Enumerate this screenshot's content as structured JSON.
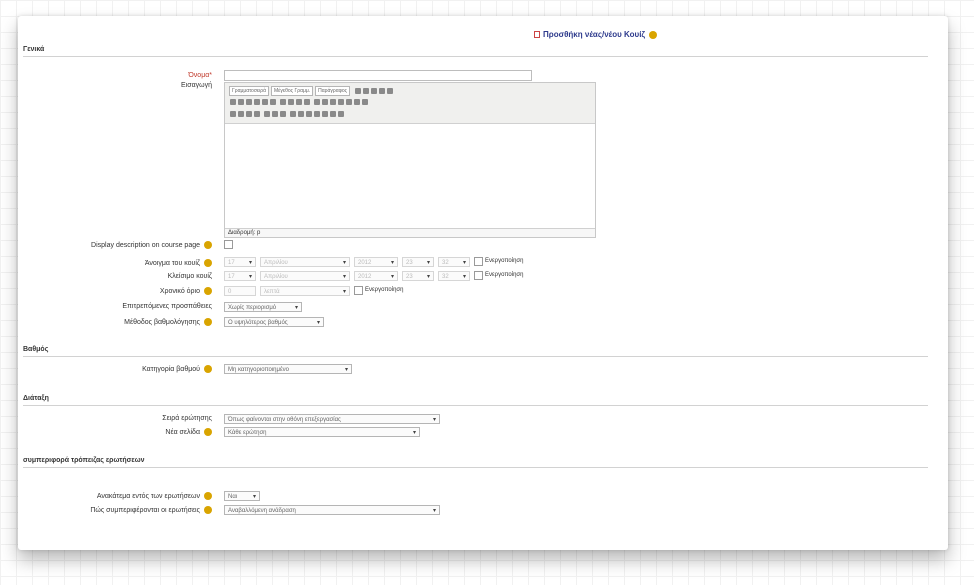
{
  "page": {
    "title": "Προσθήκη νέας/νέου Κουίζ"
  },
  "sections": {
    "general": "Γενικά",
    "grade": "Βαθμός",
    "layout": "Διάταξη",
    "behaviour": "συμπεριφορά τρόπειζας ερωτήσεων"
  },
  "general": {
    "name_label": "Όνομα*",
    "name_value": "",
    "intro_label": "Εισαγωγή",
    "editor": {
      "toolbar_selects": [
        "Γραμματοσειρά",
        "Μέγεθος Γραμμ.",
        "Παράγραφος"
      ],
      "path": "Διαδρομή: p"
    },
    "display_desc_label": "Display description on course page",
    "open_label": "Άνοιγμα του κουίζ",
    "close_label": "Κλείσιμο κουίζ",
    "timelimit_label": "Χρονικό όριο",
    "attempts_label": "Επιτρεπόμενες προσπάθειες",
    "grading_label": "Μέθοδος βαθμολόγησης",
    "open": {
      "day": "17",
      "month": "Απριλίου",
      "year": "2012",
      "hour": "23",
      "minute": "32",
      "enable": "Ενεργοποίηση"
    },
    "close": {
      "day": "17",
      "month": "Απριλίου",
      "year": "2012",
      "hour": "23",
      "minute": "32",
      "enable": "Ενεργοποίηση"
    },
    "timelimit": {
      "value": "0",
      "unit": "λεπτά",
      "enable": "Ενεργοποίηση"
    },
    "attempts_value": "Χωρίς περιορισμό",
    "grading_value": "Ο υψηλότερος βαθμός"
  },
  "grade": {
    "category_label": "Κατηγορία βαθμού",
    "category_value": "Μη κατηγοριοποιημένο"
  },
  "layout": {
    "order_label": "Σειρά ερώτησης",
    "order_value": "Όπως φαίνονται στην οθόνη επεξεργασίας",
    "newpage_label": "Νέα σελίδα",
    "newpage_value": "Κάθε ερώτηση"
  },
  "behaviour": {
    "shuffle_label": "Ανακάτεμα εντός των ερωτήσεων",
    "shuffle_value": "Ναι",
    "howbehave_label": "Πώς συμπεριφέρονται οι ερωτήσεις",
    "howbehave_value": "Αναβαλλόμενη ανάδραση"
  }
}
